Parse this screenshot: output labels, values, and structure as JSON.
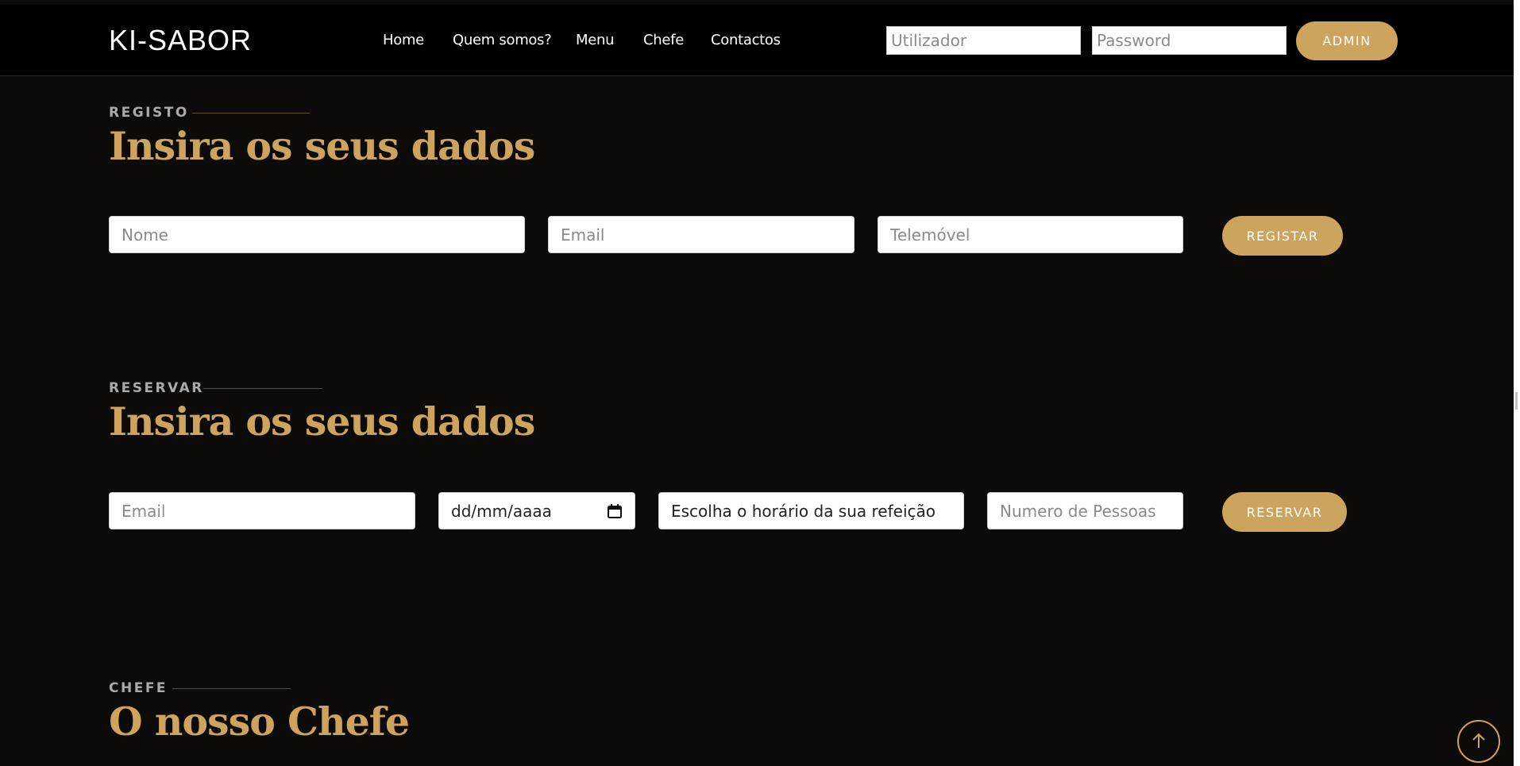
{
  "header": {
    "logo": "KI-SABOR",
    "nav": [
      "Home",
      "Quem somos?",
      "Menu",
      "Chefe",
      "Contactos"
    ],
    "login": {
      "user_placeholder": "Utilizador",
      "password_placeholder": "Password",
      "admin_label": "ADMIN"
    }
  },
  "registo": {
    "eyebrow": "REGISTO",
    "title": "Insira os seus dados",
    "name_placeholder": "Nome",
    "email_placeholder": "Email",
    "phone_placeholder": "Telemóvel",
    "button": "REGISTAR"
  },
  "reservar": {
    "eyebrow": "RESERVAR",
    "title": "Insira os seus dados",
    "email_placeholder": "Email",
    "date_value": "dd/mm/aaaa",
    "time_value": "Escolha o horário da sua refeição",
    "people_placeholder": "Numero de Pessoas",
    "button": "RESERVAR"
  },
  "chefe": {
    "eyebrow": "CHEFE",
    "title": "O nosso Chefe"
  },
  "colors": {
    "accent": "#cda45e",
    "background": "#0c0b09",
    "header": "#000000"
  },
  "icons": {
    "date": "calendar-icon",
    "back_to_top": "arrow-up-icon"
  }
}
